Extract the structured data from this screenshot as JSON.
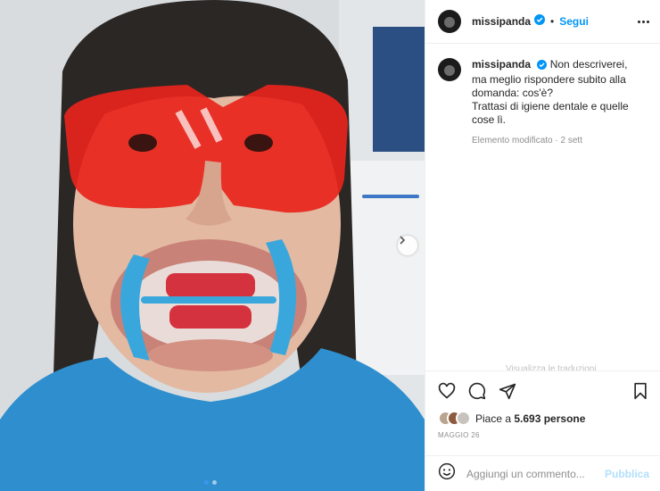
{
  "post": {
    "username": "missipanda",
    "separator": "•",
    "follow_label": "Segui",
    "more_icon": "more-horizontal-icon",
    "verified_icon": "verified-badge-icon",
    "caption_text": "Non descriverei, ma meglio rispondere subito alla domanda: cos'è?\nTrattasi di igiene dentale e quelle cose lì.",
    "edited_meta": "Elemento modificato · 2 sett",
    "faded_text": "Visualizza le traduzioni",
    "likes_prefix": "Piace a ",
    "likes_count": "5.693 persone",
    "date": "MAGGIO 26"
  },
  "actions": {
    "like_icon": "heart-icon",
    "comment_icon": "comment-icon",
    "share_icon": "send-icon",
    "save_icon": "bookmark-icon"
  },
  "comment_bar": {
    "emoji_icon": "emoji-icon",
    "placeholder": "Aggiungi un commento...",
    "publish_label": "Pubblica"
  },
  "carousel": {
    "next_icon": "chevron-right-icon",
    "slide_count": 2,
    "active_slide": 1
  },
  "colors": {
    "accent": "#0095f6",
    "publish_disabled": "#b2dffc",
    "muted": "#8e8e8e",
    "glasses_red": "#e8241c",
    "cheek_retractor_blue": "#3aa7dc",
    "bib_blue": "#2f8fce"
  }
}
